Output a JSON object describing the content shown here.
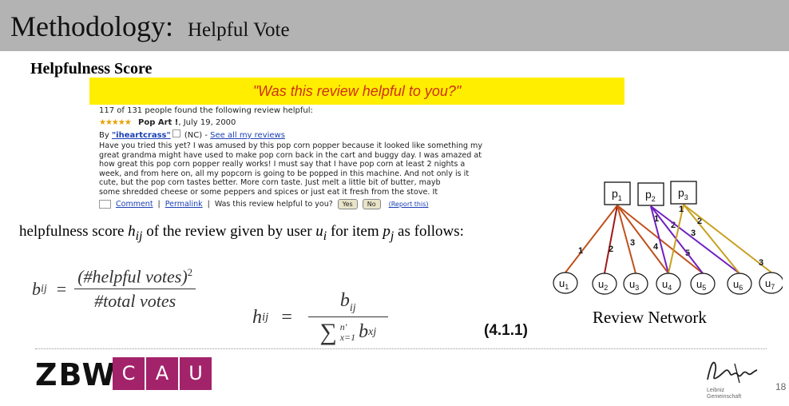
{
  "header": {
    "title": "Methodology:",
    "subtitle": "Helpful Vote"
  },
  "section_heading": "Helpfulness Score",
  "review": {
    "banner": "\"Was this review helpful to you?\"",
    "votes_line": "117 of 131 people found the following review helpful:",
    "stars": "★★★★★",
    "review_title": "Pop Art !",
    "review_date": ", July 19, 2000",
    "by_label": "By ",
    "author": "\"iheartcrass\"",
    "location": " (NC) - ",
    "see_all": "See all my reviews",
    "body": "Have you tried this yet? I was amused by this pop corn popper because it looked like something my\ngreat grandma might have used to make pop corn back in the cart and buggy day. I was amazed at\nhow great this pop corn popper really works! I must say that I have pop corn at least 2 nights a\nweek, and from here on, all my popcorn is going to be popped in this machine. And not only is it\ncute, but the pop corn tastes better. More corn taste. Just melt a little bit of butter, mayb\nsome shredded cheese or some peppers and spices or just eat it fresh from the stove. It",
    "comment": "Comment",
    "permalink": "Permalink",
    "question": "Was this review helpful to you?",
    "yes": "Yes",
    "no": "No",
    "report": "(Report this)"
  },
  "description": {
    "part1": "helpfulness score ",
    "h": "h",
    "ij": "ij",
    "part2": " of the review given by user ",
    "u": "u",
    "i": "i",
    "part3": " for item ",
    "p": "p",
    "j": "j",
    "part4": " as follows:"
  },
  "equation1": {
    "lhs": "b",
    "lhs_sub": "ij",
    "equals": "=",
    "numerator": "(#helpful votes)",
    "numerator_sup": "2",
    "denominator": "#total votes"
  },
  "equation2": {
    "lhs": "h",
    "lhs_sub": "ij",
    "equals": "=",
    "numerator": "b",
    "numerator_sub": "ij",
    "sum": "∑",
    "sum_upper": "n′",
    "sum_lower": "x=1",
    "den_var": "b",
    "den_sub": "xj"
  },
  "equation_number": "(4.1.1)",
  "network": {
    "label": "Review Network",
    "products": [
      {
        "base": "p",
        "sub": "1"
      },
      {
        "base": "p",
        "sub": "2"
      },
      {
        "base": "p",
        "sub": "3"
      }
    ],
    "users": [
      {
        "base": "u",
        "sub": "1"
      },
      {
        "base": "u",
        "sub": "2"
      },
      {
        "base": "u",
        "sub": "3"
      },
      {
        "base": "u",
        "sub": "4"
      },
      {
        "base": "u",
        "sub": "5"
      },
      {
        "base": "u",
        "sub": "6"
      },
      {
        "base": "u",
        "sub": "7"
      }
    ],
    "edges": [
      {
        "from": 0,
        "to": 0,
        "label": "1",
        "color": "#c0501c"
      },
      {
        "from": 0,
        "to": 1,
        "label": "2",
        "color": "#a01818"
      },
      {
        "from": 0,
        "to": 2,
        "label": "3",
        "color": "#c0501c"
      },
      {
        "from": 0,
        "to": 3,
        "label": "4",
        "color": "#c0501c"
      },
      {
        "from": 0,
        "to": 4,
        "label": "5",
        "color": "#c0501c"
      },
      {
        "from": 1,
        "to": 3,
        "label": "1",
        "color": "#7020c0"
      },
      {
        "from": 1,
        "to": 4,
        "label": "2",
        "color": "#7020c0"
      },
      {
        "from": 1,
        "to": 5,
        "label": "3",
        "color": "#7020c0"
      },
      {
        "from": 2,
        "to": 3,
        "label": "1",
        "color": "#c8a020"
      },
      {
        "from": 2,
        "to": 5,
        "label": "2",
        "color": "#c8a020"
      },
      {
        "from": 2,
        "to": 6,
        "label": "3",
        "color": "#c8a020"
      }
    ]
  },
  "logos": {
    "zbw": "ZBW",
    "cau": [
      "C",
      "A",
      "U"
    ],
    "leibniz_line1": "Leibniz",
    "leibniz_line2": "Gemeinschaft"
  },
  "page_number": "18",
  "colors": {
    "header_bg": "#b3b3b3",
    "banner_bg": "#ffee00",
    "banner_text": "#d03010",
    "cau_purple": "#a3236b"
  }
}
